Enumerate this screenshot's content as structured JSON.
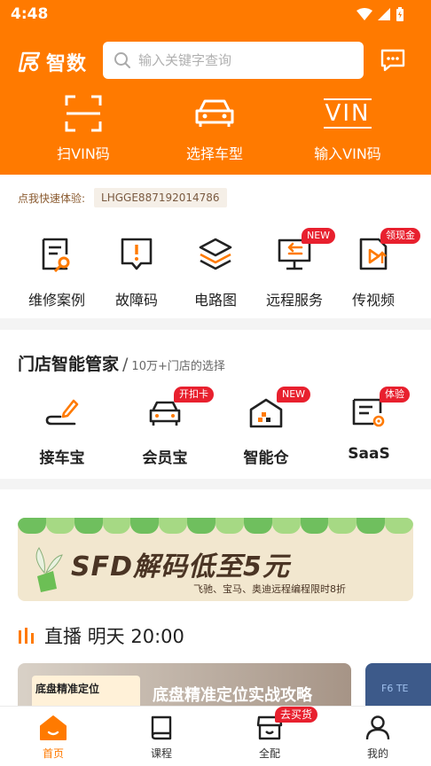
{
  "status_bar": {
    "time": "4:48"
  },
  "header": {
    "logo_text": "智数",
    "search_placeholder": "输入关键字查询",
    "quick_actions": [
      {
        "label": "扫VIN码",
        "icon": "scan-icon"
      },
      {
        "label": "选择车型",
        "icon": "car-icon"
      },
      {
        "label": "输入VIN码",
        "icon": "vin-icon",
        "icon_text": "VIN"
      }
    ]
  },
  "trial": {
    "label": "点我快速体验:",
    "code": "LHGGE887192014786"
  },
  "tools": [
    {
      "label": "维修案例",
      "icon": "repair-case-icon",
      "badge": ""
    },
    {
      "label": "故障码",
      "icon": "fault-code-icon",
      "badge": ""
    },
    {
      "label": "电路图",
      "icon": "circuit-layers-icon",
      "badge": ""
    },
    {
      "label": "远程服务",
      "icon": "remote-service-icon",
      "badge": "NEW"
    },
    {
      "label": "传视频",
      "icon": "upload-video-icon",
      "badge": "领现金"
    }
  ],
  "store": {
    "title": "门店智能管家",
    "separator": "/",
    "subtitle": "10万+门店的选择",
    "items": [
      {
        "label": "接车宝",
        "icon": "pen-road-icon",
        "badge": ""
      },
      {
        "label": "会员宝",
        "icon": "member-car-icon",
        "badge": "开扣卡"
      },
      {
        "label": "智能仓",
        "icon": "warehouse-icon",
        "badge": "NEW"
      },
      {
        "label": "SaaS",
        "icon": "saas-icon",
        "badge": "体验"
      }
    ]
  },
  "banner": {
    "title": "SFD解码低至5元",
    "subtitle": "飞驰、宝马、奥迪远程编程限时8折"
  },
  "live": {
    "title": "直播 明天 20:00"
  },
  "live_card": {
    "thumb_text": "底盘精准定位",
    "title": "底盘精准定位实战攻略",
    "side_text": "F6 TE"
  },
  "tabbar": [
    {
      "label": "首页",
      "icon": "home-icon",
      "active": true,
      "badge": ""
    },
    {
      "label": "课程",
      "icon": "book-icon",
      "active": false,
      "badge": ""
    },
    {
      "label": "全配",
      "icon": "store-icon",
      "active": false,
      "badge": "去买货"
    },
    {
      "label": "我的",
      "icon": "user-icon",
      "active": false,
      "badge": ""
    }
  ],
  "colors": {
    "brand": "#ff7a00",
    "badge": "#e8202e",
    "text": "#222222"
  }
}
